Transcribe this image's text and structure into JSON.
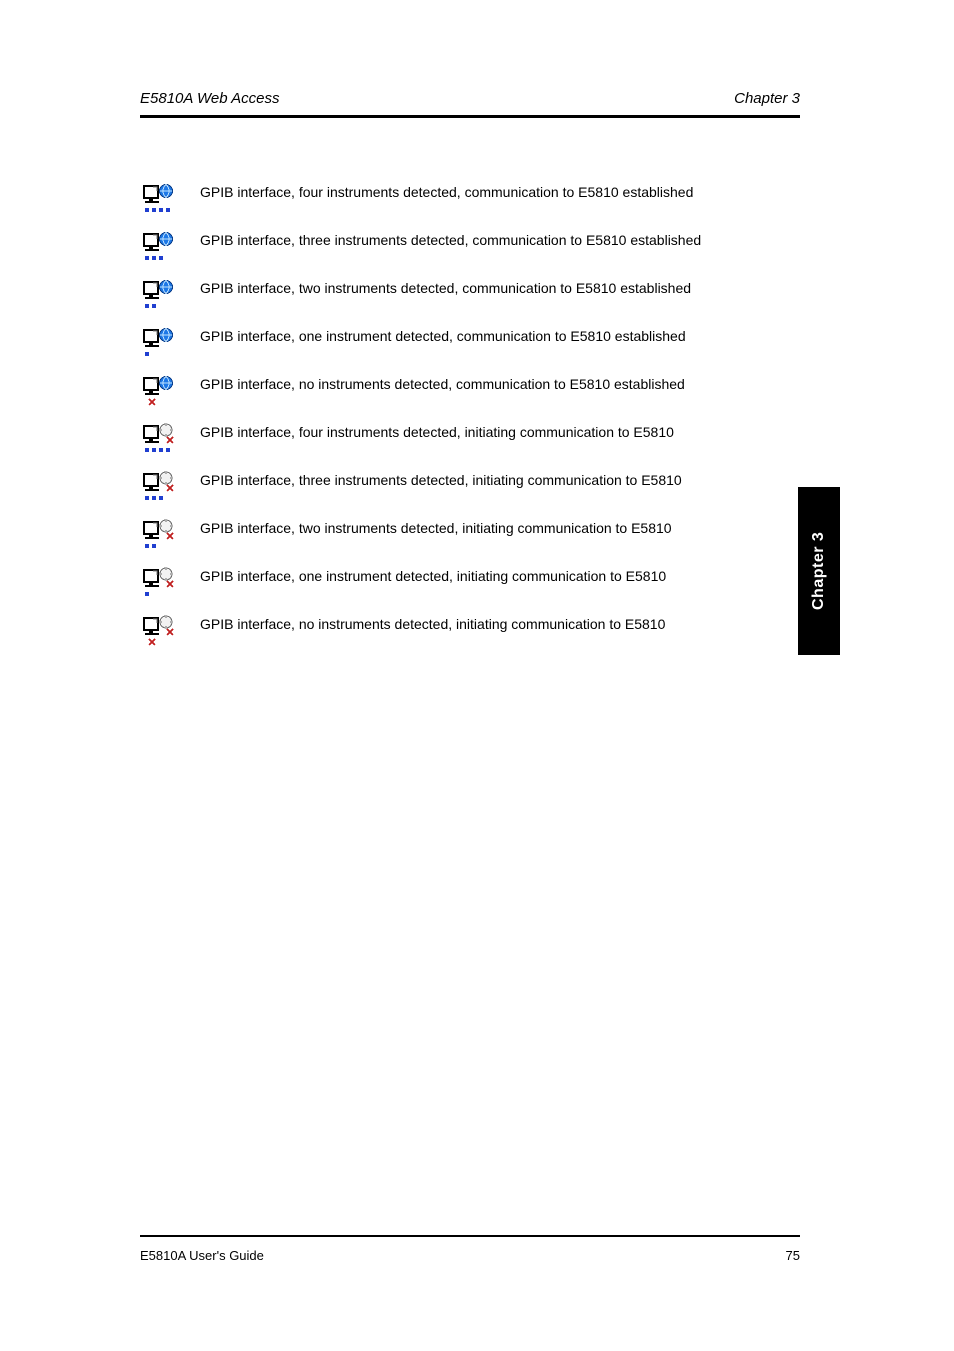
{
  "header": {
    "left": "E5810A Web Access",
    "right": "Chapter 3"
  },
  "icons": {
    "monitor_stroke": "#000000",
    "monitor_fill": "#ffffff",
    "globe_fill": "#1e78e6",
    "globe_stroke": "#0b3e8a",
    "pending_fill": "#f2f2f2",
    "pending_stroke": "#6a6a6a",
    "pending_x": "#c02020",
    "instrument_dot": "#203fd0",
    "instrument_x": "#c22020"
  },
  "rows": [
    {
      "dots": 4,
      "x": false,
      "status": "globe",
      "desc": "GPIB interface, four instruments detected, communication to E5810 established"
    },
    {
      "dots": 3,
      "x": false,
      "status": "globe",
      "desc": "GPIB interface, three instruments detected, communication to E5810 established"
    },
    {
      "dots": 2,
      "x": false,
      "status": "globe",
      "desc": "GPIB interface, two instruments detected, communication to E5810 established"
    },
    {
      "dots": 1,
      "x": false,
      "status": "globe",
      "desc": "GPIB interface, one instrument detected, communication to E5810 established"
    },
    {
      "dots": 0,
      "x": true,
      "status": "globe",
      "desc": "GPIB interface, no instruments detected, communication to E5810 established"
    },
    {
      "dots": 4,
      "x": false,
      "status": "pending",
      "desc": "GPIB interface, four instruments detected, initiating communication to E5810"
    },
    {
      "dots": 3,
      "x": false,
      "status": "pending",
      "desc": "GPIB interface, three instruments detected, initiating communication to E5810"
    },
    {
      "dots": 2,
      "x": false,
      "status": "pending",
      "desc": "GPIB interface, two instruments detected, initiating communication to E5810"
    },
    {
      "dots": 1,
      "x": false,
      "status": "pending",
      "desc": "GPIB interface, one instrument detected, initiating communication to E5810"
    },
    {
      "dots": 0,
      "x": true,
      "status": "pending",
      "desc": "GPIB interface, no instruments detected, initiating communication to E5810"
    }
  ],
  "side_tab": "Chapter 3",
  "footer": {
    "left": "E5810A User's Guide",
    "right": "75"
  }
}
